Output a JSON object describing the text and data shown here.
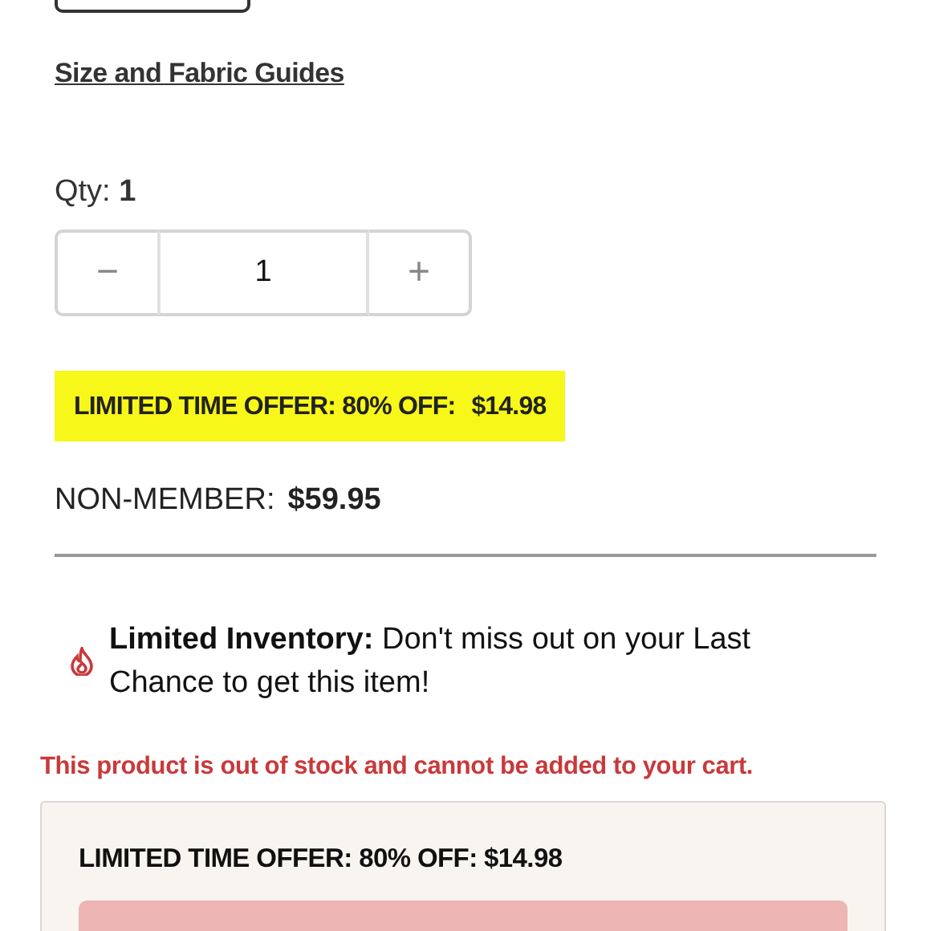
{
  "guide_link": "Size and Fabric Guides",
  "quantity": {
    "label": "Qty:",
    "value": "1",
    "minus": "−",
    "input": "1",
    "plus": "+"
  },
  "offer": {
    "label": "LIMITED TIME OFFER: 80% OFF:",
    "price": "$14.98"
  },
  "non_member": {
    "label": "NON-MEMBER:",
    "price": "$59.95"
  },
  "notice": "**Limited Inventory:** Don't miss out on your Last Chance to get this item!",
  "error": "This product is out of stock and cannot be added to your cart.",
  "card": {
    "offer": "LIMITED TIME OFFER: 80% OFF: $14.98",
    "button_disabled": true
  }
}
